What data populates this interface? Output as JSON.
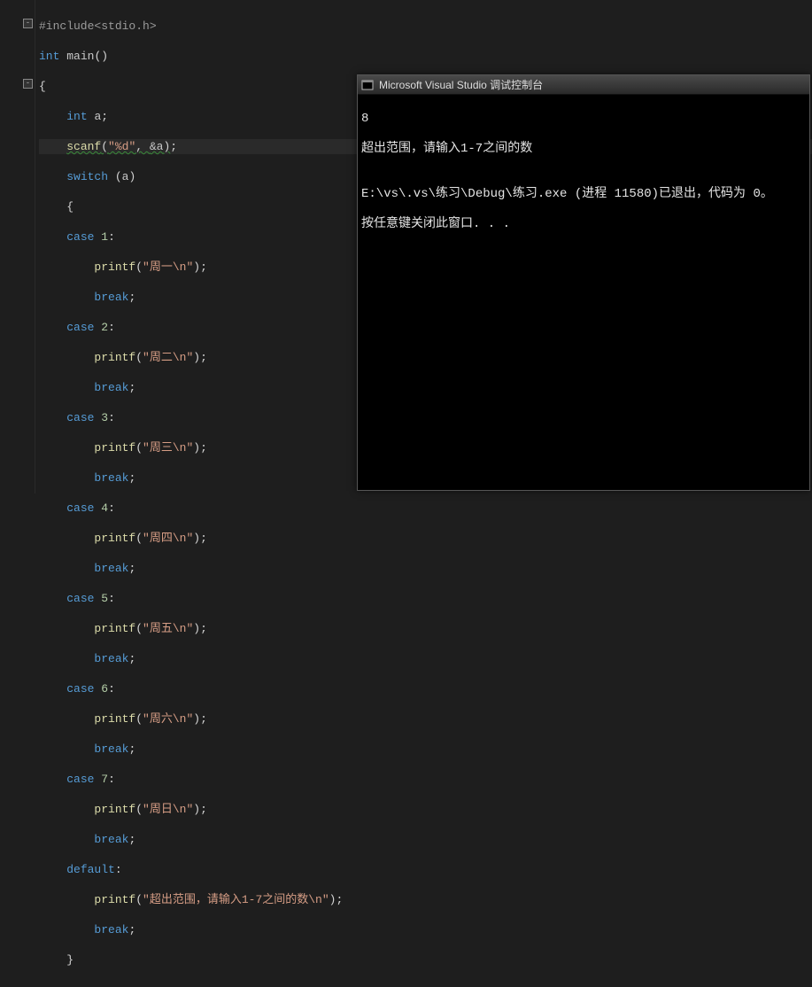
{
  "code": {
    "include": "#include<stdio.h>",
    "int": "int",
    "main": "main",
    "void_paren": "()",
    "obrace": "{",
    "decl_int": "int",
    "decl_a": "a",
    "semi": ";",
    "scanf": "scanf",
    "scanf_fmt": "\"%d\"",
    "scanf_arg": "&a",
    "switch": "switch",
    "switch_arg": "a",
    "case": "case",
    "c1": "1",
    "c2": "2",
    "c3": "3",
    "c4": "4",
    "c5": "5",
    "c6": "6",
    "c7": "7",
    "colon": ":",
    "printf": "printf",
    "s1": "\"周一\\n\"",
    "s2": "\"周二\\n\"",
    "s3": "\"周三\\n\"",
    "s4": "\"周四\\n\"",
    "s5": "\"周五\\n\"",
    "s6": "\"周六\\n\"",
    "s7": "\"周日\\n\"",
    "sdef": "\"超出范围，请输入1-7之间的数\\n\"",
    "break": "break",
    "default": "default",
    "cbrace": "}"
  },
  "console": {
    "title": "Microsoft Visual Studio 调试控制台",
    "line1": "8",
    "line2": "超出范围，请输入1-7之间的数",
    "blank": "",
    "line3": "E:\\vs\\.vs\\练习\\Debug\\练习.exe (进程 11580)已退出，代码为 0。",
    "line4": "按任意键关闭此窗口. . ."
  }
}
